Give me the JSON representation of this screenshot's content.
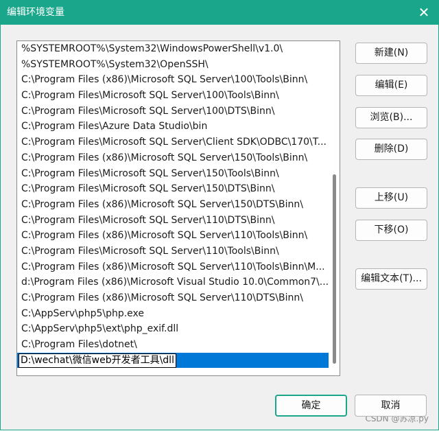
{
  "window": {
    "title": "编辑环境变量",
    "close_glyph": "✕"
  },
  "path_list": {
    "items": [
      "%SYSTEMROOT%\\System32\\WindowsPowerShell\\v1.0\\",
      "%SYSTEMROOT%\\System32\\OpenSSH\\",
      "C:\\Program Files (x86)\\Microsoft SQL Server\\100\\Tools\\Binn\\",
      "C:\\Program Files\\Microsoft SQL Server\\100\\Tools\\Binn\\",
      "C:\\Program Files\\Microsoft SQL Server\\100\\DTS\\Binn\\",
      "C:\\Program Files\\Azure Data Studio\\bin",
      "C:\\Program Files\\Microsoft SQL Server\\Client SDK\\ODBC\\170\\T...",
      "C:\\Program Files (x86)\\Microsoft SQL Server\\150\\Tools\\Binn\\",
      "C:\\Program Files\\Microsoft SQL Server\\150\\Tools\\Binn\\",
      "C:\\Program Files\\Microsoft SQL Server\\150\\DTS\\Binn\\",
      "C:\\Program Files (x86)\\Microsoft SQL Server\\150\\DTS\\Binn\\",
      "C:\\Program Files\\Microsoft SQL Server\\110\\DTS\\Binn\\",
      "C:\\Program Files (x86)\\Microsoft SQL Server\\110\\Tools\\Binn\\",
      "C:\\Program Files\\Microsoft SQL Server\\110\\Tools\\Binn\\",
      "C:\\Program Files (x86)\\Microsoft SQL Server\\110\\Tools\\Binn\\M...",
      "d:\\Program Files (x86)\\Microsoft Visual Studio 10.0\\Common7\\...",
      "C:\\Program Files (x86)\\Microsoft SQL Server\\110\\DTS\\Binn\\",
      "C:\\AppServ\\php5\\php.exe",
      "C:\\AppServ\\php5\\ext\\php_exif.dll",
      "C:\\Program Files\\dotnet\\"
    ],
    "editing_value": "D:\\wechat\\微信web开发者工具\\dll"
  },
  "buttons": {
    "new": "新建(N)",
    "edit": "编辑(E)",
    "browse": "浏览(B)...",
    "delete": "删除(D)",
    "move_up": "上移(U)",
    "move_down": "下移(O)",
    "edit_text": "编辑文本(T)...",
    "ok": "确定",
    "cancel": "取消"
  },
  "watermark": "CSDN @苏凉.py",
  "colors": {
    "accent": "#1aa68a",
    "selection": "#0078d7"
  }
}
